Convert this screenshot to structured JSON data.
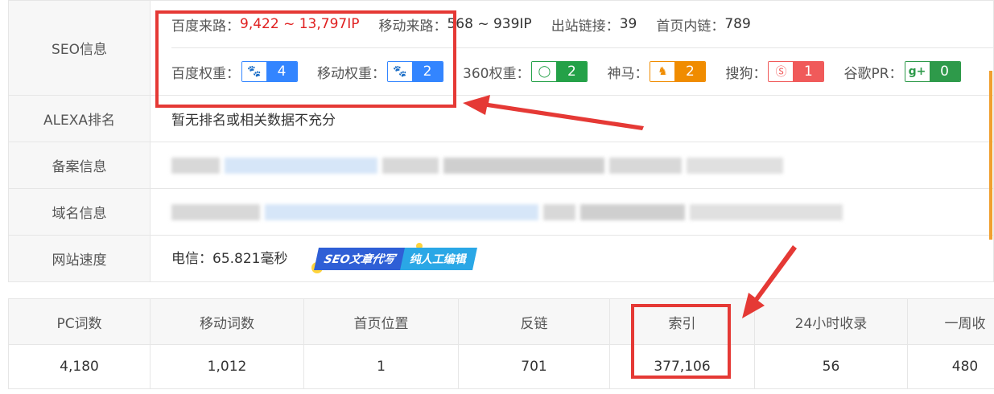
{
  "seo": {
    "label": "SEO信息",
    "baidu_traffic_label": "百度来路：",
    "baidu_traffic_value": "9,422 ~ 13,797",
    "ip_unit": " IP",
    "mobile_traffic_label": "移动来路：",
    "mobile_traffic_value": "568 ~ 939",
    "outbound_label": "出站链接：",
    "outbound_value": "39",
    "internal_label": "首页内链：",
    "internal_value": "789",
    "baidu_weight_label": "百度权重：",
    "baidu_weight_value": "4",
    "mobile_weight_label": "移动权重：",
    "mobile_weight_value": "2",
    "w360_label": "360权重：",
    "w360_value": "2",
    "shenma_label": "神马：",
    "shenma_value": "2",
    "sogou_label": "搜狗：",
    "sogou_value": "1",
    "google_label": "谷歌PR：",
    "google_value": "0"
  },
  "alexa": {
    "label": "ALEXA排名",
    "value": "暂无排名或相关数据不充分"
  },
  "icp": {
    "label": "备案信息"
  },
  "domain": {
    "label": "域名信息"
  },
  "speed": {
    "label": "网站速度",
    "value": "电信：65.821毫秒",
    "promo_part1": "SEO文章代写",
    "promo_part2": "纯人工编辑"
  },
  "stats": {
    "headers": [
      "PC词数",
      "移动词数",
      "首页位置",
      "反链",
      "索引",
      "24小时收录",
      "一周收"
    ],
    "values": [
      "4,180",
      "1,012",
      "1",
      "701",
      "377,106",
      "56",
      "480"
    ]
  },
  "icons": {
    "baidu": "paw-icon",
    "mobile_baidu": "mobile-paw-icon",
    "so360": "360-ring-icon",
    "shenma": "shenma-horse-icon",
    "sogou": "sogou-s-icon",
    "google": "google-plus-icon"
  },
  "colors": {
    "highlight_red": "#e53935",
    "traffic_red": "#e02020",
    "baidu_blue": "#3385ff",
    "green": "#24a148",
    "orange": "#f08c00",
    "sogou_red": "#f05a5a"
  }
}
